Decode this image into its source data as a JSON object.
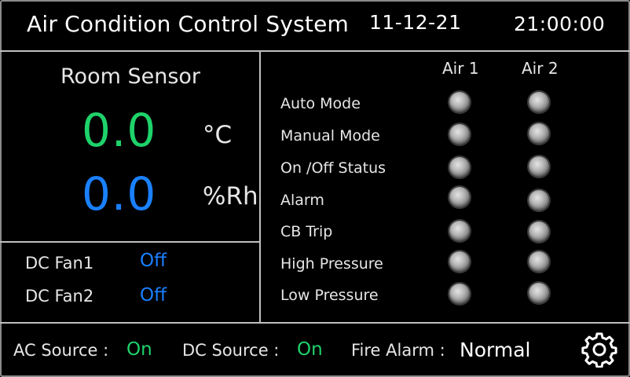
{
  "header": {
    "title": "Air Condition Control System",
    "date": "11-12-21",
    "time": "21:00:00"
  },
  "sensor": {
    "title": "Room Sensor",
    "temperature": "0.0",
    "temperature_unit": "°C",
    "humidity": "0.0",
    "humidity_unit": "%Rh"
  },
  "fans": [
    {
      "label": "DC Fan1",
      "value": "Off"
    },
    {
      "label": "DC Fan2",
      "value": "Off"
    }
  ],
  "status_panel": {
    "columns": [
      "Air 1",
      "Air 2"
    ],
    "rows": [
      {
        "label": "Auto Mode"
      },
      {
        "label": "Manual Mode"
      },
      {
        "label": "On /Off Status"
      },
      {
        "label": "Alarm"
      },
      {
        "label": "CB Trip"
      },
      {
        "label": "High Pressure"
      },
      {
        "label": "Low Pressure"
      }
    ]
  },
  "footer": {
    "ac_source_label": "AC Source :",
    "ac_source_value": "On",
    "dc_source_label": "DC Source :",
    "dc_source_value": "On",
    "fire_alarm_label": "Fire Alarm :",
    "fire_alarm_value": "Normal"
  },
  "icons": {
    "settings": "gear-icon",
    "indicator": "status-led"
  },
  "colors": {
    "background": "#000000",
    "temperature": "#1ed36a",
    "humidity": "#1a80ff",
    "fan_status": "#1a80ff",
    "source_on": "#1ed36a",
    "divider": "#bfbfbf",
    "led_off": "#b8b8b8"
  }
}
